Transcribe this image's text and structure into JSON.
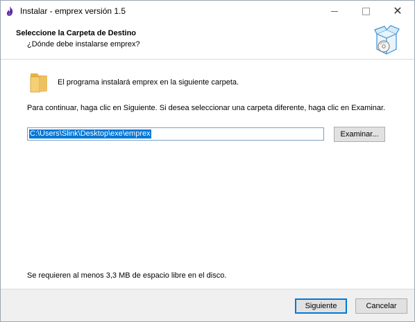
{
  "window": {
    "title": "Instalar - emprex versión 1.5",
    "controls": {
      "minimize": "minimize",
      "maximize": "maximize",
      "close": "✕"
    }
  },
  "header": {
    "title": "Seleccione la Carpeta de Destino",
    "subtitle": "¿Dónde debe instalarse emprex?"
  },
  "body": {
    "intro": "El programa instalará emprex en la siguiente carpeta.",
    "instructions": "Para continuar, haga clic en Siguiente. Si desea seleccionar una carpeta diferente, haga clic en Examinar.",
    "path_value": "C:\\Users\\Slink\\Desktop\\exe\\emprex",
    "browse_label": "Examinar...",
    "space_required": "Se requieren al menos 3,3 MB de espacio libre en el disco."
  },
  "footer": {
    "next_label": "Siguiente",
    "cancel_label": "Cancelar"
  },
  "icons": {
    "app": "flame-icon",
    "header": "install-box-disc-icon",
    "folder": "folder-icon"
  },
  "colors": {
    "selection": "#0078d7",
    "footer_bg": "#f0f0f0",
    "button_bg": "#e1e1e1"
  }
}
